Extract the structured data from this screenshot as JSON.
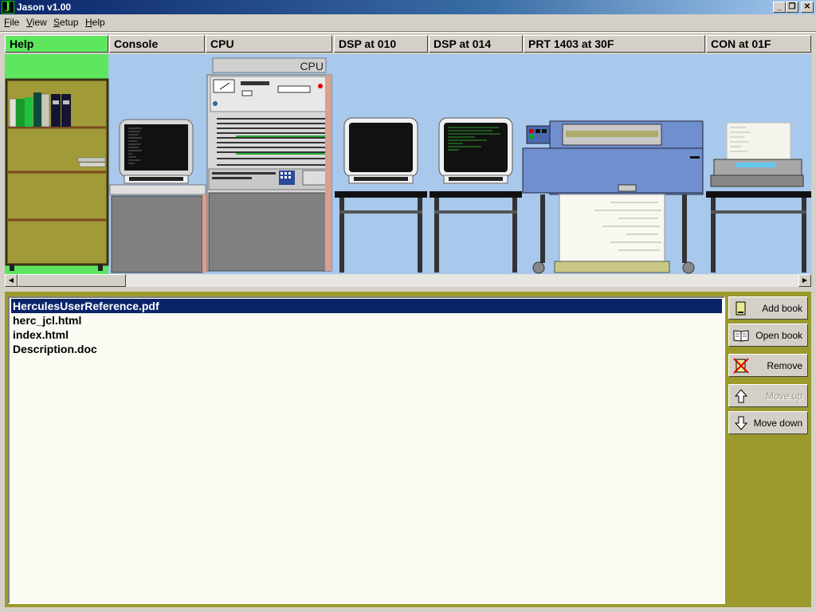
{
  "window": {
    "title": "Jason v1.00",
    "icon_letter": "J"
  },
  "menu": [
    {
      "accel": "F",
      "rest": "ile"
    },
    {
      "accel": "V",
      "rest": "iew"
    },
    {
      "accel": "S",
      "rest": "etup"
    },
    {
      "accel": "H",
      "rest": "elp"
    }
  ],
  "tabs": [
    "Help",
    "Console",
    "CPU",
    "DSP at 010",
    "DSP at 014",
    "PRT 1403 at 30F",
    "CON at 01F"
  ],
  "active_tab": "Help",
  "scene": {
    "cpu_label": "CPU"
  },
  "books": {
    "items": [
      "HerculesUserReference.pdf",
      "herc_jcl.html",
      "index.html",
      "Description.doc"
    ],
    "selected": "HerculesUserReference.pdf"
  },
  "actions": {
    "add": "Add book",
    "open": "Open book",
    "remove": "Remove",
    "up": "Move up",
    "down": "Move down"
  },
  "colors": {
    "active_tab": "#5ee65e",
    "scene_bg": "#a8c8ec",
    "panel_bg": "#9c9a2c",
    "selection": "#0a246a",
    "bookcase": "#a09a38",
    "printer": "#6f8fcf"
  }
}
